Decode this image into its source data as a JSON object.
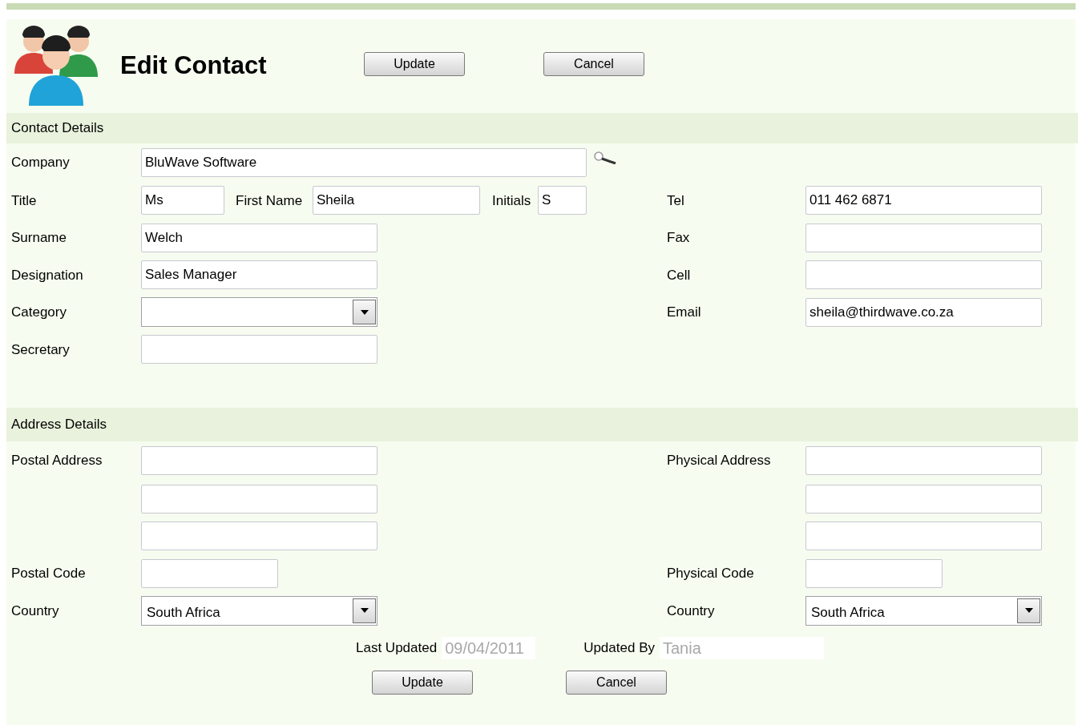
{
  "header": {
    "title": "Edit Contact",
    "buttons": [
      {
        "label": "Update"
      },
      {
        "label": "Cancel"
      }
    ]
  },
  "contact_details": {
    "heading": "Contact Details",
    "company": {
      "label": "Company",
      "value": "BluWave Software"
    },
    "title": {
      "label": "Title",
      "value": "Ms"
    },
    "first_name": {
      "label": "First Name",
      "value": "Sheila"
    },
    "initials": {
      "label": "Initials",
      "value": "S"
    },
    "surname": {
      "label": "Surname",
      "value": "Welch"
    },
    "designation": {
      "label": "Designation",
      "value": "Sales Manager"
    },
    "category": {
      "label": "Category"
    },
    "secretary": {
      "label": "Secretary"
    },
    "tel": {
      "label": "Tel",
      "value": "011 462 6871"
    },
    "fax": {
      "label": "Fax"
    },
    "cell": {
      "label": "Cell"
    },
    "email": {
      "label": "Email",
      "value": "sheila@thirdwave.co.za"
    }
  },
  "address_details": {
    "heading": "Address Details",
    "postal_address": {
      "label": "Postal Address"
    },
    "physical_address": {
      "label": "Physical Address"
    },
    "postal_code": {
      "label": "Postal Code"
    },
    "physical_code": {
      "label": "Physical Code"
    },
    "postal_country": {
      "label": "Country",
      "value": "South Africa"
    },
    "physical_country": {
      "label": "Country",
      "value": "South Africa"
    }
  },
  "footer": {
    "last_updated": {
      "label": "Last Updated",
      "value": "09/04/2011",
      "disabled": true
    },
    "updated_by": {
      "label": "Updated By",
      "value": "Tania",
      "disabled": true
    },
    "buttons": [
      {
        "label": "Update"
      },
      {
        "label": "Cancel"
      }
    ]
  }
}
